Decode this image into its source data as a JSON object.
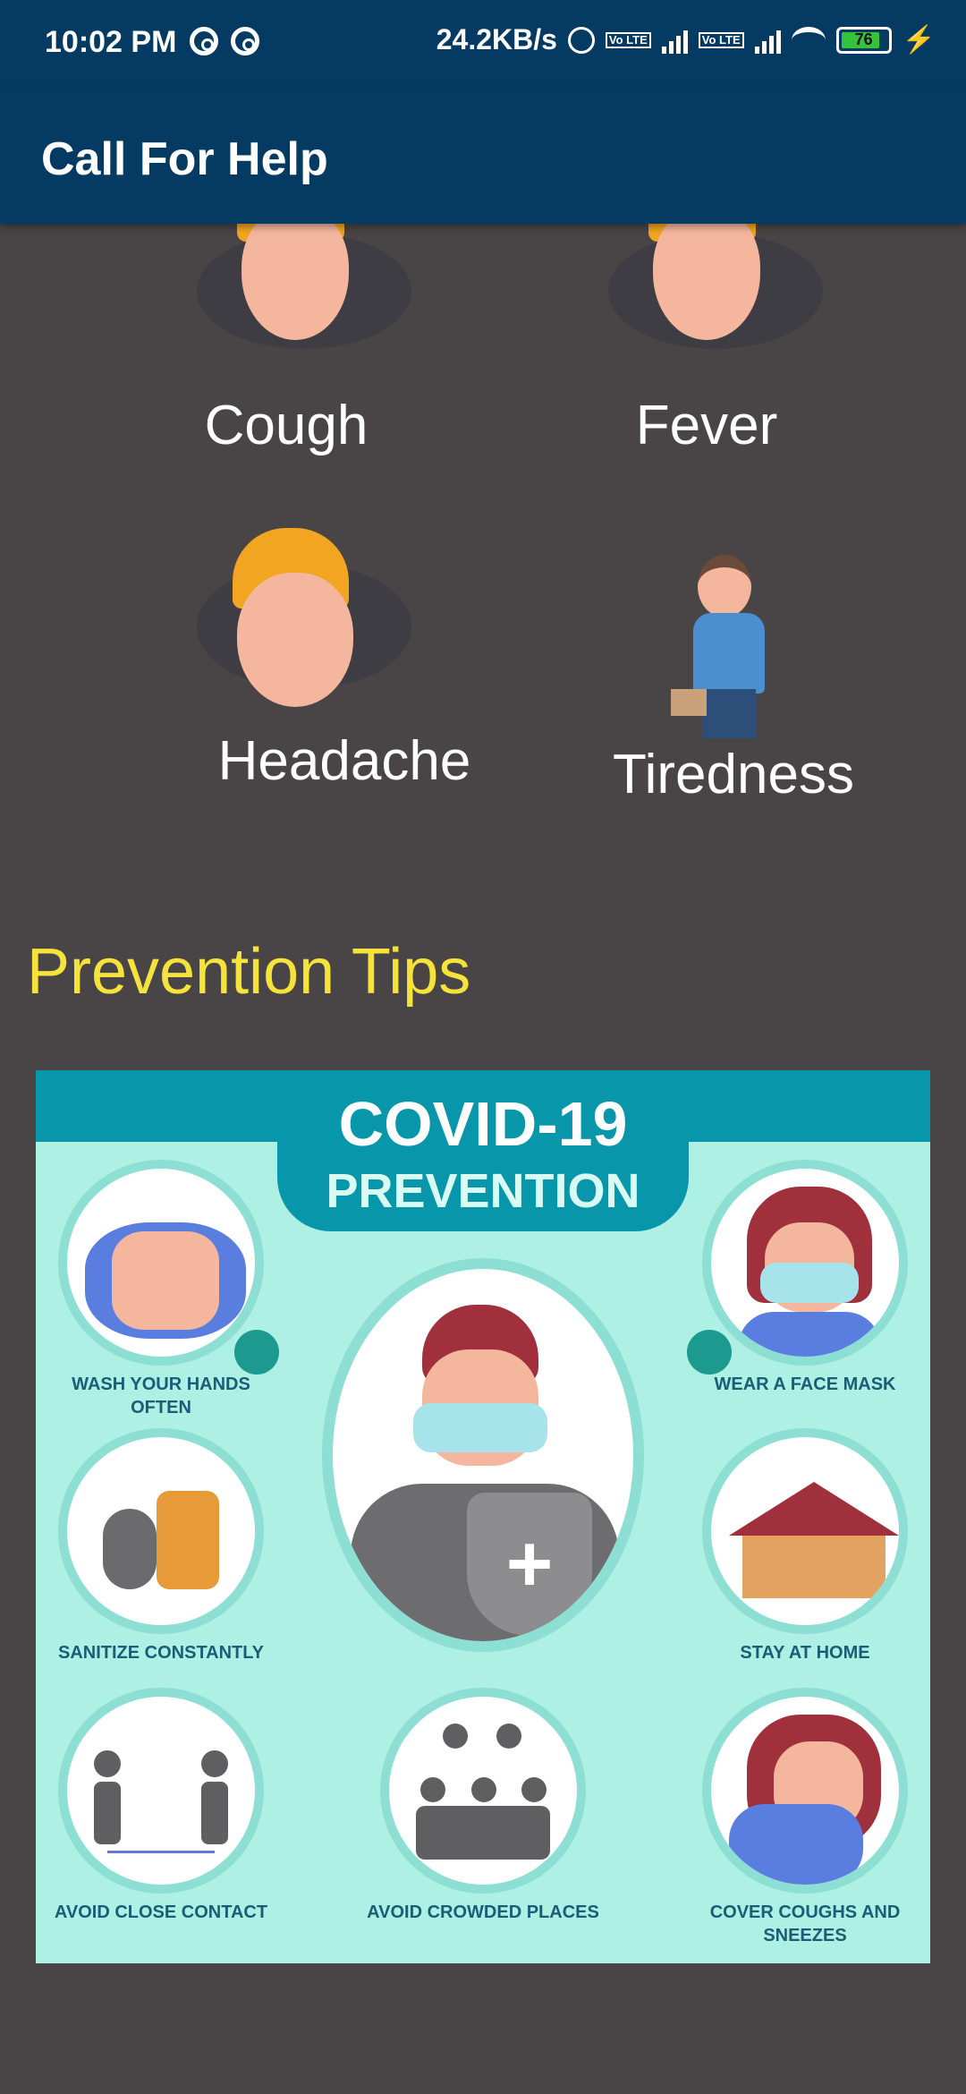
{
  "status_bar": {
    "time": "10:02 PM",
    "net_speed": "24.2KB/s",
    "sim_tag": "Vo LTE",
    "battery": "76"
  },
  "app_bar": {
    "title": "Call For Help"
  },
  "symptoms": [
    {
      "label": "Cough",
      "icon": "coughing-face-icon"
    },
    {
      "label": "Fever",
      "icon": "fever-face-icon"
    },
    {
      "label": "Headache",
      "icon": "dizzy-face-icon"
    },
    {
      "label": "Tiredness",
      "icon": "tired-man-icon"
    }
  ],
  "prevention": {
    "heading": "Prevention Tips",
    "poster": {
      "title": "COVID-19",
      "subtitle": "PREVENTION",
      "tips": [
        "WASH YOUR HANDS OFTEN",
        "SANITIZE CONSTANTLY",
        "AVOID CLOSE CONTACT",
        "AVOID CROWDED PLACES",
        "WEAR A FACE MASK",
        "STAY AT HOME",
        "COVER COUGHS AND SNEEZES"
      ]
    }
  },
  "colors": {
    "app_bar": "#053b63",
    "background": "#494546",
    "heading_accent": "#f5e23a",
    "poster_teal": "#0896ab",
    "poster_bg": "#aef0e3"
  }
}
